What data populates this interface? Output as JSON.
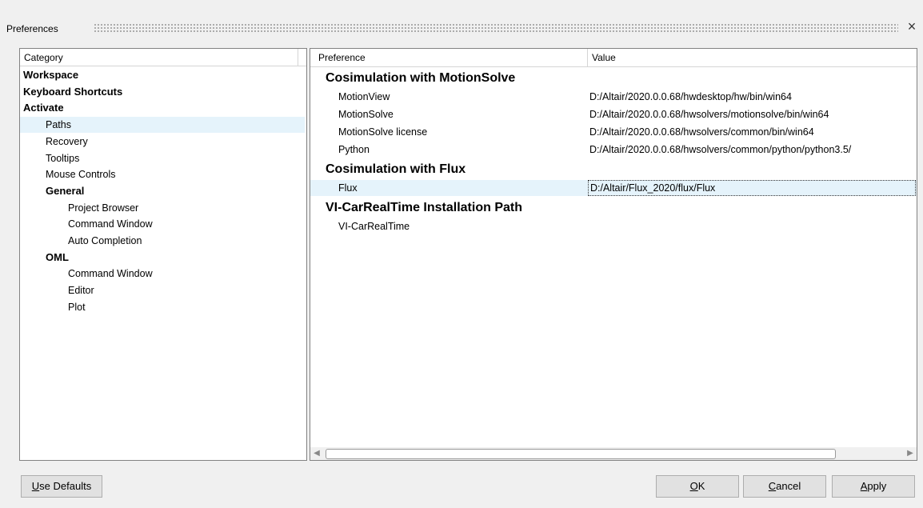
{
  "window": {
    "title": "Preferences",
    "close_label": "×"
  },
  "category": {
    "header": "Category",
    "items": [
      {
        "label": "Workspace",
        "bold": true,
        "indent": 0,
        "selected": false
      },
      {
        "label": "Keyboard Shortcuts",
        "bold": true,
        "indent": 0,
        "selected": false
      },
      {
        "label": "Activate",
        "bold": true,
        "indent": 0,
        "selected": false
      },
      {
        "label": "Paths",
        "bold": false,
        "indent": 1,
        "selected": true
      },
      {
        "label": "Recovery",
        "bold": false,
        "indent": 1,
        "selected": false
      },
      {
        "label": "Tooltips",
        "bold": false,
        "indent": 1,
        "selected": false
      },
      {
        "label": "Mouse Controls",
        "bold": false,
        "indent": 1,
        "selected": false
      },
      {
        "label": "General",
        "bold": true,
        "indent": 1,
        "selected": false
      },
      {
        "label": "Project Browser",
        "bold": false,
        "indent": 2,
        "selected": false
      },
      {
        "label": "Command Window",
        "bold": false,
        "indent": 2,
        "selected": false
      },
      {
        "label": "Auto Completion",
        "bold": false,
        "indent": 2,
        "selected": false
      },
      {
        "label": "OML",
        "bold": true,
        "indent": 1,
        "selected": false
      },
      {
        "label": "Command Window",
        "bold": false,
        "indent": 2,
        "selected": false
      },
      {
        "label": "Editor",
        "bold": false,
        "indent": 2,
        "selected": false
      },
      {
        "label": "Plot",
        "bold": false,
        "indent": 2,
        "selected": false
      }
    ]
  },
  "preferences": {
    "header_preference": "Preference",
    "header_value": "Value",
    "groups": [
      {
        "title": "Cosimulation with MotionSolve",
        "rows": [
          {
            "name": "MotionView",
            "value": "D:/Altair/2020.0.0.68/hwdesktop/hw/bin/win64",
            "selected": false
          },
          {
            "name": "MotionSolve",
            "value": "D:/Altair/2020.0.0.68/hwsolvers/motionsolve/bin/win64",
            "selected": false
          },
          {
            "name": "MotionSolve license",
            "value": "D:/Altair/2020.0.0.68/hwsolvers/common/bin/win64",
            "selected": false
          },
          {
            "name": "Python",
            "value": "D:/Altair/2020.0.0.68/hwsolvers/common/python/python3.5/",
            "selected": false
          }
        ]
      },
      {
        "title": "Cosimulation with Flux",
        "rows": [
          {
            "name": "Flux",
            "value": "D:/Altair/Flux_2020/flux/Flux",
            "selected": true
          }
        ]
      },
      {
        "title": "VI-CarRealTime Installation Path",
        "rows": [
          {
            "name": "VI-CarRealTime",
            "value": "",
            "selected": false
          }
        ]
      }
    ]
  },
  "buttons": {
    "use_defaults": {
      "mnemonic": "U",
      "rest": "se Defaults"
    },
    "ok": {
      "mnemonic": "O",
      "rest": "K"
    },
    "cancel": {
      "mnemonic": "C",
      "rest": "ancel"
    },
    "apply": {
      "mnemonic": "A",
      "rest": "pply"
    }
  }
}
